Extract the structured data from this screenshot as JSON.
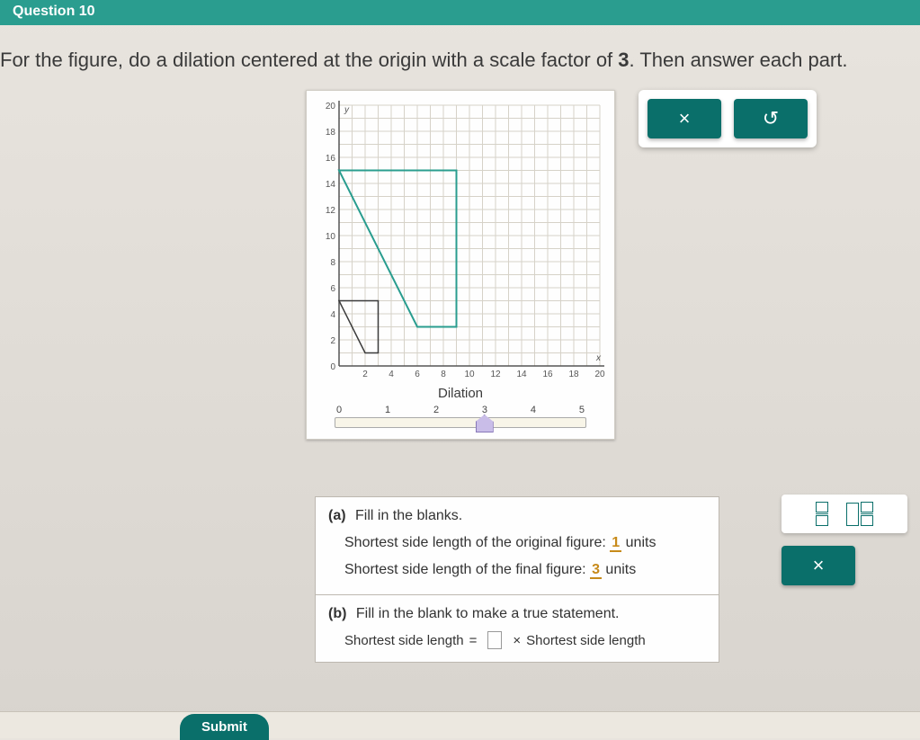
{
  "header": {
    "question_label": "Question 10"
  },
  "prompt": {
    "before": "For the figure, do a dilation centered at the origin with a scale factor of ",
    "scale": "3",
    "after": ". Then answer each part."
  },
  "buttons": {
    "close": "×",
    "reset": "↺",
    "close2": "×"
  },
  "graph": {
    "axis_max": 20,
    "y_ticks": [
      "20",
      "18",
      "16",
      "14",
      "12",
      "10",
      "8",
      "6",
      "4",
      "2",
      "0"
    ],
    "x_ticks": [
      "0",
      "2",
      "4",
      "6",
      "8",
      "10",
      "12",
      "14",
      "16",
      "18",
      "20"
    ],
    "y_axis_var": "y",
    "x_axis_var": "x",
    "original_figure": [
      [
        0,
        5
      ],
      [
        3,
        5
      ],
      [
        3,
        1
      ],
      [
        2,
        1
      ]
    ],
    "dilated_figure": [
      [
        0,
        15
      ],
      [
        9,
        15
      ],
      [
        9,
        3
      ],
      [
        6,
        3
      ]
    ]
  },
  "slider": {
    "label": "Dilation",
    "ticks": [
      "0",
      "1",
      "2",
      "3",
      "4",
      "5"
    ],
    "value": 3
  },
  "parts": {
    "a": {
      "label": "(a)",
      "heading": "Fill in the blanks.",
      "line1_before": "Shortest side length of the original figure: ",
      "line1_val": "1",
      "line1_after": " units",
      "line2_before": "Shortest side length of the final figure: ",
      "line2_val": "3",
      "line2_after": " units"
    },
    "b": {
      "label": "(b)",
      "heading": "Fill in the blank to make a true statement.",
      "lhs": "Shortest side length",
      "eq": "=",
      "times": "×",
      "rhs": "Shortest side length"
    }
  },
  "tools": {
    "fraction": "fraction",
    "mixed": "mixed-number"
  },
  "footer": {
    "submit": "Submit"
  }
}
